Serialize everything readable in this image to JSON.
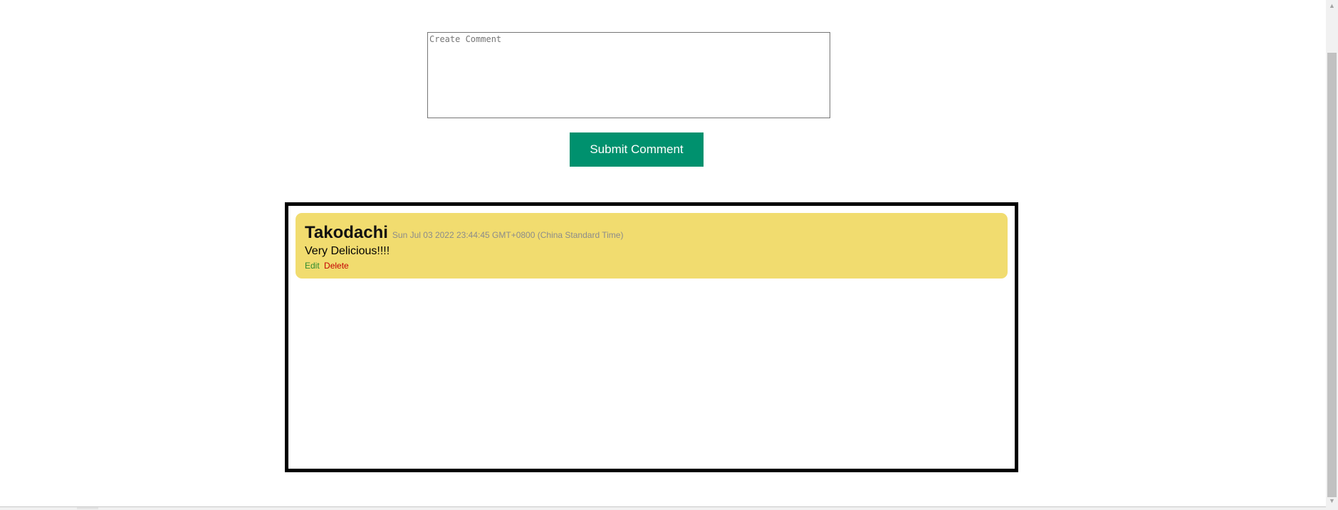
{
  "comment_form": {
    "placeholder": "Create Comment",
    "value": "",
    "submit_label": "Submit Comment"
  },
  "comments": [
    {
      "author": "Takodachi",
      "date": "Sun Jul 03 2022 23:44:45 GMT+0800 (China Standard Time)",
      "text": "Very Delicious!!!!",
      "edit_label": "Edit",
      "delete_label": "Delete"
    }
  ],
  "colors": {
    "submit_button": "#00916e",
    "comment_card": "#f1dc6f",
    "edit_link": "#2e8b2e",
    "delete_link": "#c40000"
  },
  "scrollbar": {
    "up_icon": "arrow-up-icon",
    "down_icon": "arrow-down-icon"
  }
}
